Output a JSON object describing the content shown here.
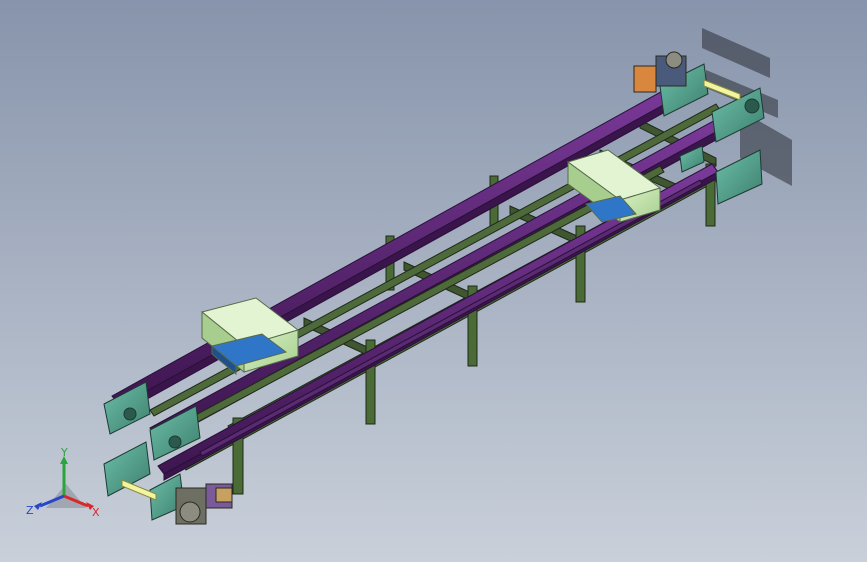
{
  "viewport": {
    "background_top": "#8794ab",
    "background_bottom": "#c9d0da"
  },
  "model": {
    "frame_color": "#4f6a3a",
    "rail_color": "#6a2f86",
    "rail_edge_color": "#2a103a",
    "plate_color": "#5aa795",
    "block_color": "#c8e8b2",
    "carriage_color": "#2f76c8",
    "roller_color": "#f1f4a0",
    "motor_color": "#6d6f63"
  },
  "triad": {
    "x_label": "X",
    "y_label": "Y",
    "z_label": "Z",
    "x_color": "#d9282a",
    "y_color": "#2aa43b",
    "z_color": "#2746c8"
  }
}
